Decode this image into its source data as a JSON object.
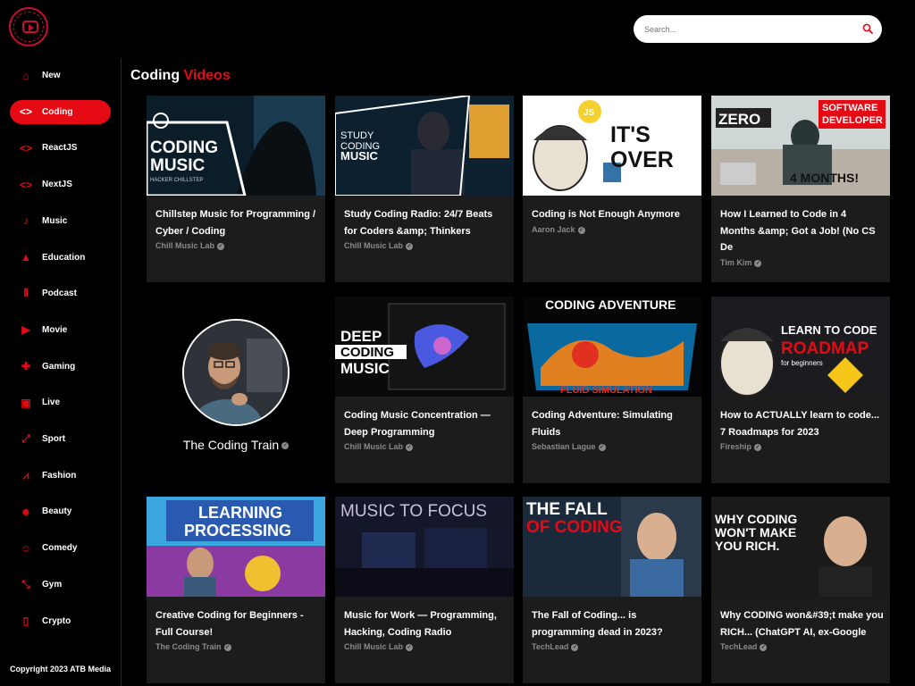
{
  "brand": {
    "name": "ATB Media"
  },
  "search": {
    "placeholder": "Search..."
  },
  "page": {
    "title_prefix": "Coding",
    "title_highlight": "Videos"
  },
  "sidebar": {
    "items": [
      {
        "label": "New",
        "icon": "home-icon",
        "active": false
      },
      {
        "label": "Coding",
        "icon": "code-icon",
        "active": true
      },
      {
        "label": "ReactJS",
        "icon": "code-icon",
        "active": false
      },
      {
        "label": "NextJS",
        "icon": "code-icon",
        "active": false
      },
      {
        "label": "Music",
        "icon": "music-note-icon",
        "active": false
      },
      {
        "label": "Education",
        "icon": "graduation-cap-icon",
        "active": false
      },
      {
        "label": "Podcast",
        "icon": "audio-waveform-icon",
        "active": false
      },
      {
        "label": "Movie",
        "icon": "video-player-icon",
        "active": false
      },
      {
        "label": "Gaming",
        "icon": "gamepad-icon",
        "active": false
      },
      {
        "label": "Live",
        "icon": "live-tv-icon",
        "active": false
      },
      {
        "label": "Sport",
        "icon": "sport-icon",
        "active": false
      },
      {
        "label": "Fashion",
        "icon": "hanger-icon",
        "active": false
      },
      {
        "label": "Beauty",
        "icon": "face-icon",
        "active": false
      },
      {
        "label": "Comedy",
        "icon": "theater-icon",
        "active": false
      },
      {
        "label": "Gym",
        "icon": "dumbbell-icon",
        "active": false
      },
      {
        "label": "Crypto",
        "icon": "currency-icon",
        "active": false
      }
    ],
    "copyright": "Copyright 2023 ATB Media"
  },
  "channel_card": {
    "name": "The Coding Train"
  },
  "videos": [
    {
      "title": "Chillstep Music for Programming / Cyber / Coding",
      "channel": "Chill Music Lab",
      "thumb_text": [
        "CODING",
        "MUSIC",
        "HACKER CHILLSTEP"
      ]
    },
    {
      "title": "Study Coding Radio: 24/7 Beats for Coders &amp; Thinkers",
      "channel": "Chill Music Lab",
      "thumb_text": [
        "STUDY",
        "CODING",
        "MUSIC"
      ]
    },
    {
      "title": "Coding is Not Enough Anymore",
      "channel": "Aaron Jack",
      "thumb_text": [
        "JS",
        "IT'S",
        "OVER"
      ]
    },
    {
      "title": "How I Learned to Code in 4 Months &amp; Got a Job! (No CS De",
      "channel": "Tim Kim",
      "thumb_text": [
        "ZERO",
        "SOFTWARE",
        "DEVELOPER",
        "4 MONTHS!"
      ]
    },
    {
      "title": "Coding Music Concentration — Deep Programming",
      "channel": "Chill Music Lab",
      "thumb_text": [
        "DEEP",
        "CODING",
        "MUSIC"
      ]
    },
    {
      "title": "Coding Adventure: Simulating Fluids",
      "channel": "Sebastian Lague",
      "thumb_text": [
        "CODING ADVENTURE",
        "FLUID SIMULATION"
      ]
    },
    {
      "title": "How to ACTUALLY learn to code... 7 Roadmaps for 2023",
      "channel": "Fireship",
      "thumb_text": [
        "LEARN TO CODE",
        "ROADMAP",
        "for beginners"
      ]
    },
    {
      "title": "Creative Coding for Beginners - Full Course!",
      "channel": "The Coding Train",
      "thumb_text": [
        "LEARNING",
        "PROCESSING"
      ]
    },
    {
      "title": "Music for Work — Programming, Hacking, Coding Radio",
      "channel": "Chill Music Lab",
      "thumb_text": [
        "MUSIC TO FOCUS"
      ]
    },
    {
      "title": "The Fall of Coding... is programming dead in 2023?",
      "channel": "TechLead",
      "thumb_text": [
        "THE FALL",
        "OF CODING"
      ]
    },
    {
      "title": "Why CODING won&#39;t make you RICH... (ChatGPT AI, ex-Google",
      "channel": "TechLead",
      "thumb_text": [
        "WHY CODING",
        "WON'T MAKE",
        "YOU RICH."
      ]
    }
  ],
  "colors": {
    "accent": "#e50914",
    "background": "#000000",
    "card": "#1c1c1c",
    "muted": "#8a8a8a"
  }
}
